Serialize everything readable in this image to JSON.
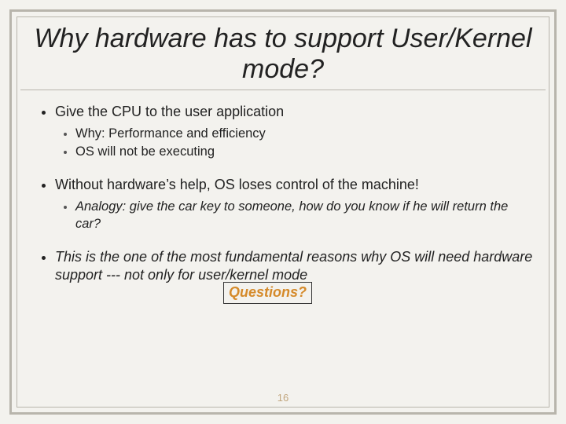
{
  "title": "Why hardware has to support User/Kernel mode?",
  "bullets": {
    "b1": "Give the CPU to the user application",
    "b1s1": "Why: Performance and efficiency",
    "b1s2": "OS will not be executing",
    "b2": "Without hardware’s help, OS loses control of the machine!",
    "b2s1": "Analogy: give the car key to someone, how do you know if he will return the car?",
    "b3": "This is the one of the most fundamental reasons why OS will need hardware support --- not only for user/kernel mode"
  },
  "callout": "Questions?",
  "page_number": "16"
}
